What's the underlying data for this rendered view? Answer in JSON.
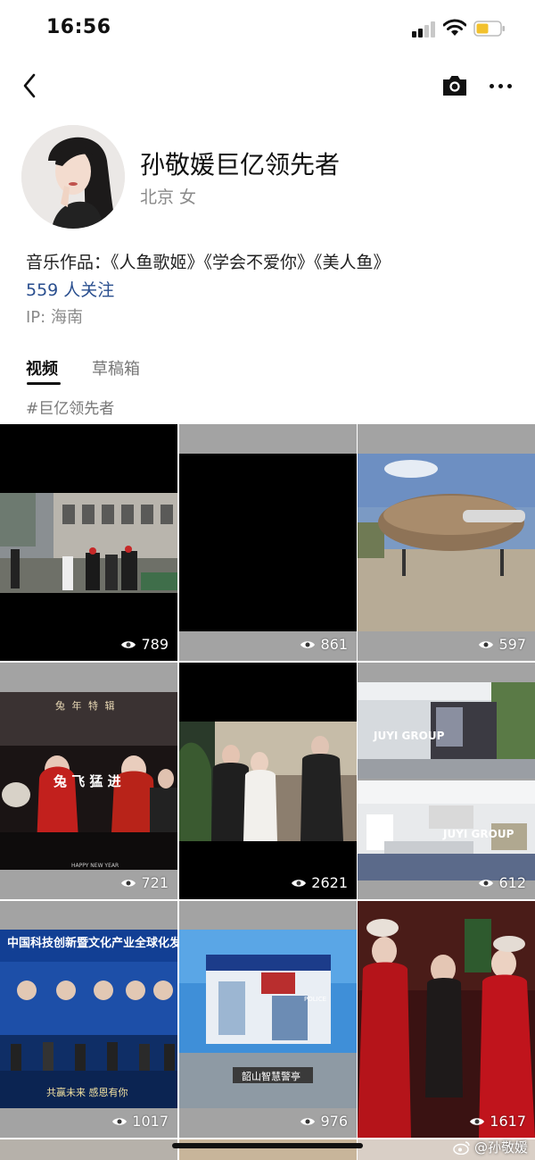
{
  "status_bar": {
    "time": "16:56"
  },
  "profile": {
    "name": "孙敬媛巨亿领先者",
    "location": "北京 女",
    "bio": "音乐作品：《人鱼歌姬》《学会不爱你》《美人鱼》",
    "following": "559 人关注",
    "ip": "IP: 海南"
  },
  "tabs": [
    {
      "label": "视频",
      "active": true
    },
    {
      "label": "草稿箱",
      "active": false
    }
  ],
  "hashtag": "#巨亿领先者",
  "videos": [
    {
      "views": "789",
      "thumbnail": "street construction workers"
    },
    {
      "views": "861",
      "thumbnail": "black frame"
    },
    {
      "views": "597",
      "thumbnail": "wooden pod house"
    },
    {
      "views": "721",
      "thumbnail": "stage performance",
      "overlay_top": "兔 年 特 辑",
      "overlay_mid": "兔 飞 猛 进",
      "overlay_bottom": "HAPPY NEW YEAR"
    },
    {
      "views": "2621",
      "thumbnail": "meeting reception"
    },
    {
      "views": "612",
      "thumbnail": "office furniture",
      "overlay_mid": "JUYI GROUP"
    },
    {
      "views": "1017",
      "thumbnail": "forum stage",
      "overlay_top": "中国科技创新暨文化产业全球化发展",
      "overlay_bottom": "共赢未来 感恩有你"
    },
    {
      "views": "976",
      "thumbnail": "police kiosk",
      "overlay_top": "POLICE",
      "overlay_mid": "韶山智慧警亭"
    },
    {
      "views": "1617",
      "thumbnail": "christmas party"
    }
  ],
  "watermark": "@孙敬媛",
  "colors": {
    "link": "#2a4f8f",
    "secondary_text": "#8a8a8a",
    "battery": "#f2c12e"
  }
}
